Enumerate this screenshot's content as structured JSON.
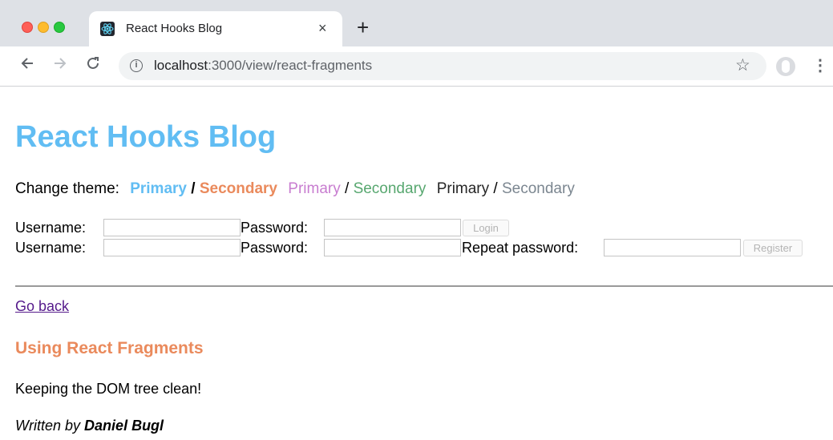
{
  "browser": {
    "tab_title": "React Hooks Blog",
    "tab_close": "×",
    "new_tab": "+",
    "url_host": "localhost",
    "url_rest": ":3000/view/react-fragments",
    "icons": {
      "back": "arrow-left-icon",
      "forward": "arrow-right-icon",
      "reload": "reload-icon",
      "info": "info-icon",
      "bookmark": "star-icon",
      "profile": "avatar-icon",
      "menu": "kebab-menu-icon"
    }
  },
  "page": {
    "title": "React Hooks Blog",
    "theme": {
      "label": "Change theme:",
      "options": [
        {
          "primary": "Primary",
          "separator": "/",
          "secondary": "Secondary",
          "primary_color": "#61bdf3",
          "secondary_color": "#ea8a5c"
        },
        {
          "primary": "Primary",
          "separator": "/",
          "secondary": "Secondary",
          "primary_color": "#c87dd0",
          "secondary_color": "#57a76f"
        },
        {
          "primary": "Primary",
          "separator": "/",
          "secondary": "Secondary",
          "primary_color": "#262626",
          "secondary_color": "#7b8690"
        }
      ]
    },
    "login": {
      "username_label": "Username:",
      "username_value": "",
      "password_label": "Password:",
      "password_value": "",
      "button": "Login"
    },
    "register": {
      "username_label": "Username:",
      "username_value": "",
      "password_label": "Password:",
      "password_value": "",
      "repeat_label": "Repeat password:",
      "repeat_value": "",
      "button": "Register"
    },
    "go_back": "Go back",
    "post": {
      "title": "Using React Fragments",
      "content": "Keeping the DOM tree clean!",
      "byline_prefix": "Written by",
      "author": "Daniel Bugl"
    }
  }
}
